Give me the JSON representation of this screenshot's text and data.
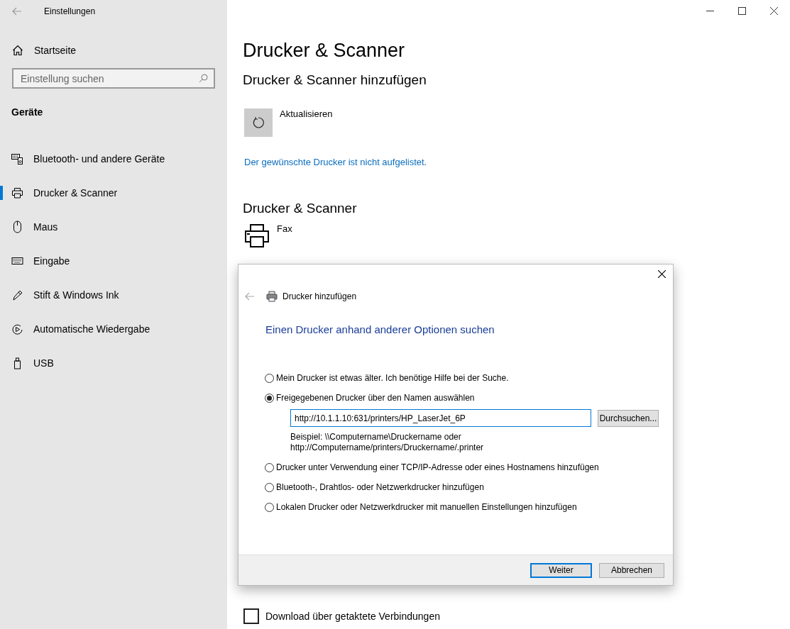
{
  "window": {
    "title": "Einstellungen"
  },
  "sidebar": {
    "home": "Startseite",
    "search": {
      "placeholder": "Einstellung suchen"
    },
    "section": "Geräte",
    "items": [
      {
        "label": "Bluetooth- und andere Geräte",
        "selected": false
      },
      {
        "label": "Drucker & Scanner",
        "selected": true
      },
      {
        "label": "Maus",
        "selected": false
      },
      {
        "label": "Eingabe",
        "selected": false
      },
      {
        "label": "Stift & Windows Ink",
        "selected": false
      },
      {
        "label": "Automatische Wiedergabe",
        "selected": false
      },
      {
        "label": "USB",
        "selected": false
      }
    ]
  },
  "main": {
    "title": "Drucker & Scanner",
    "add_heading": "Drucker & Scanner hinzufügen",
    "refresh": "Aktualisieren",
    "link": "Der gewünschte Drucker ist nicht aufgelistet.",
    "list_heading": "Drucker & Scanner",
    "printers": [
      "Fax"
    ],
    "metered": {
      "label": "Download über getaktete Verbindungen",
      "checked": false
    }
  },
  "dialog": {
    "title": "Drucker hinzufügen",
    "heading": "Einen Drucker anhand anderer Optionen suchen",
    "options": [
      {
        "label": "Mein Drucker ist etwas älter. Ich benötige Hilfe bei der Suche.",
        "selected": false
      },
      {
        "label": "Freigegebenen Drucker über den Namen auswählen",
        "selected": true,
        "value": "http://10.1.1.10:631/printers/HP_LaserJet_6P",
        "browse": "Durchsuchen...",
        "hint": [
          "Beispiel: \\\\Computername\\Druckername oder",
          "http://Computername/printers/Druckername/.printer"
        ]
      },
      {
        "label": "Drucker unter Verwendung einer TCP/IP-Adresse oder eines Hostnamens hinzufügen",
        "selected": false
      },
      {
        "label": "Bluetooth-, Drahtlos- oder Netzwerkdrucker hinzufügen",
        "selected": false
      },
      {
        "label": "Lokalen Drucker oder Netzwerkdrucker mit manuellen Einstellungen hinzufügen",
        "selected": false
      }
    ],
    "buttons": [
      {
        "label": "Weiter",
        "kind": "default"
      },
      {
        "label": "Abbrechen",
        "kind": "normal"
      }
    ]
  }
}
